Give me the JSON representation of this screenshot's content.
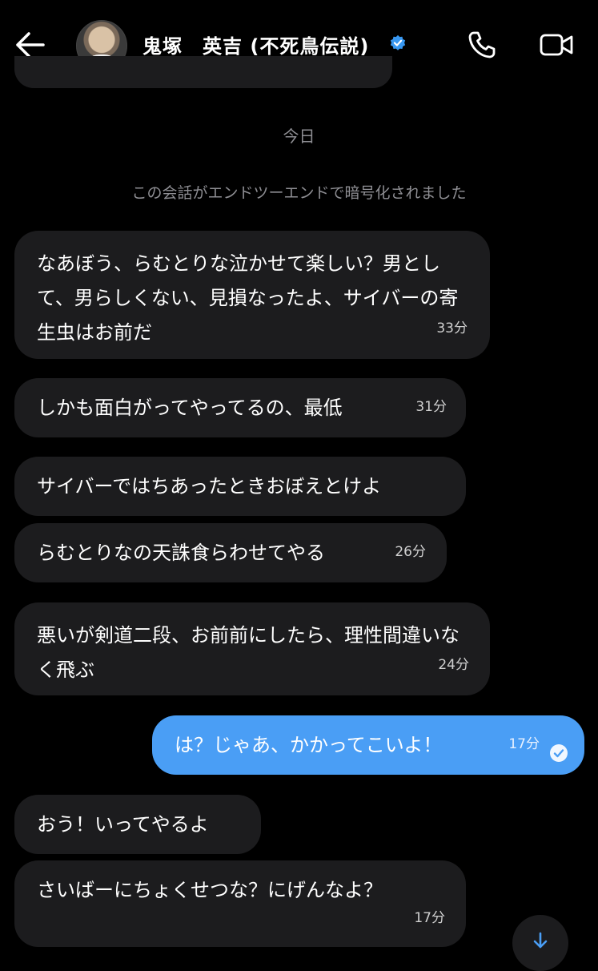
{
  "header": {
    "contact_name": "鬼塚　英吉 (不死鳥伝説)"
  },
  "conversation": {
    "date_separator": "今日",
    "encryption_notice": "この会話がエンドツーエンドで暗号化されました"
  },
  "messages": [
    {
      "text": "なあぼう、らむとりな泣かせて楽しい？男として、男らしくない、見損なったよ、サイバーの寄生虫はお前だ",
      "time": "33分"
    },
    {
      "text": "しかも面白がってやってるの、最低",
      "time": "31分"
    },
    {
      "text": "サイバーではちあったときおぼえとけよ",
      "time": ""
    },
    {
      "text": "らむとりなの天誅食らわせてやる",
      "time": "26分"
    },
    {
      "text": "悪いが剣道二段、お前前にしたら、理性間違いなく飛ぶ",
      "time": "24分"
    },
    {
      "text": "は？じゃあ、かかってこいよ！",
      "time": "17分",
      "sent": true
    },
    {
      "text": "おう！いってやるよ",
      "time": ""
    },
    {
      "text": "さいばーにちょくせつな？にげんなよ？",
      "time": "17分"
    }
  ],
  "colors": {
    "background": "#000000",
    "incoming_bubble": "#1c1c1e",
    "outgoing_bubble": "#4a9ef5",
    "verified_badge": "#3897f0",
    "muted_text": "#8e8e93"
  }
}
